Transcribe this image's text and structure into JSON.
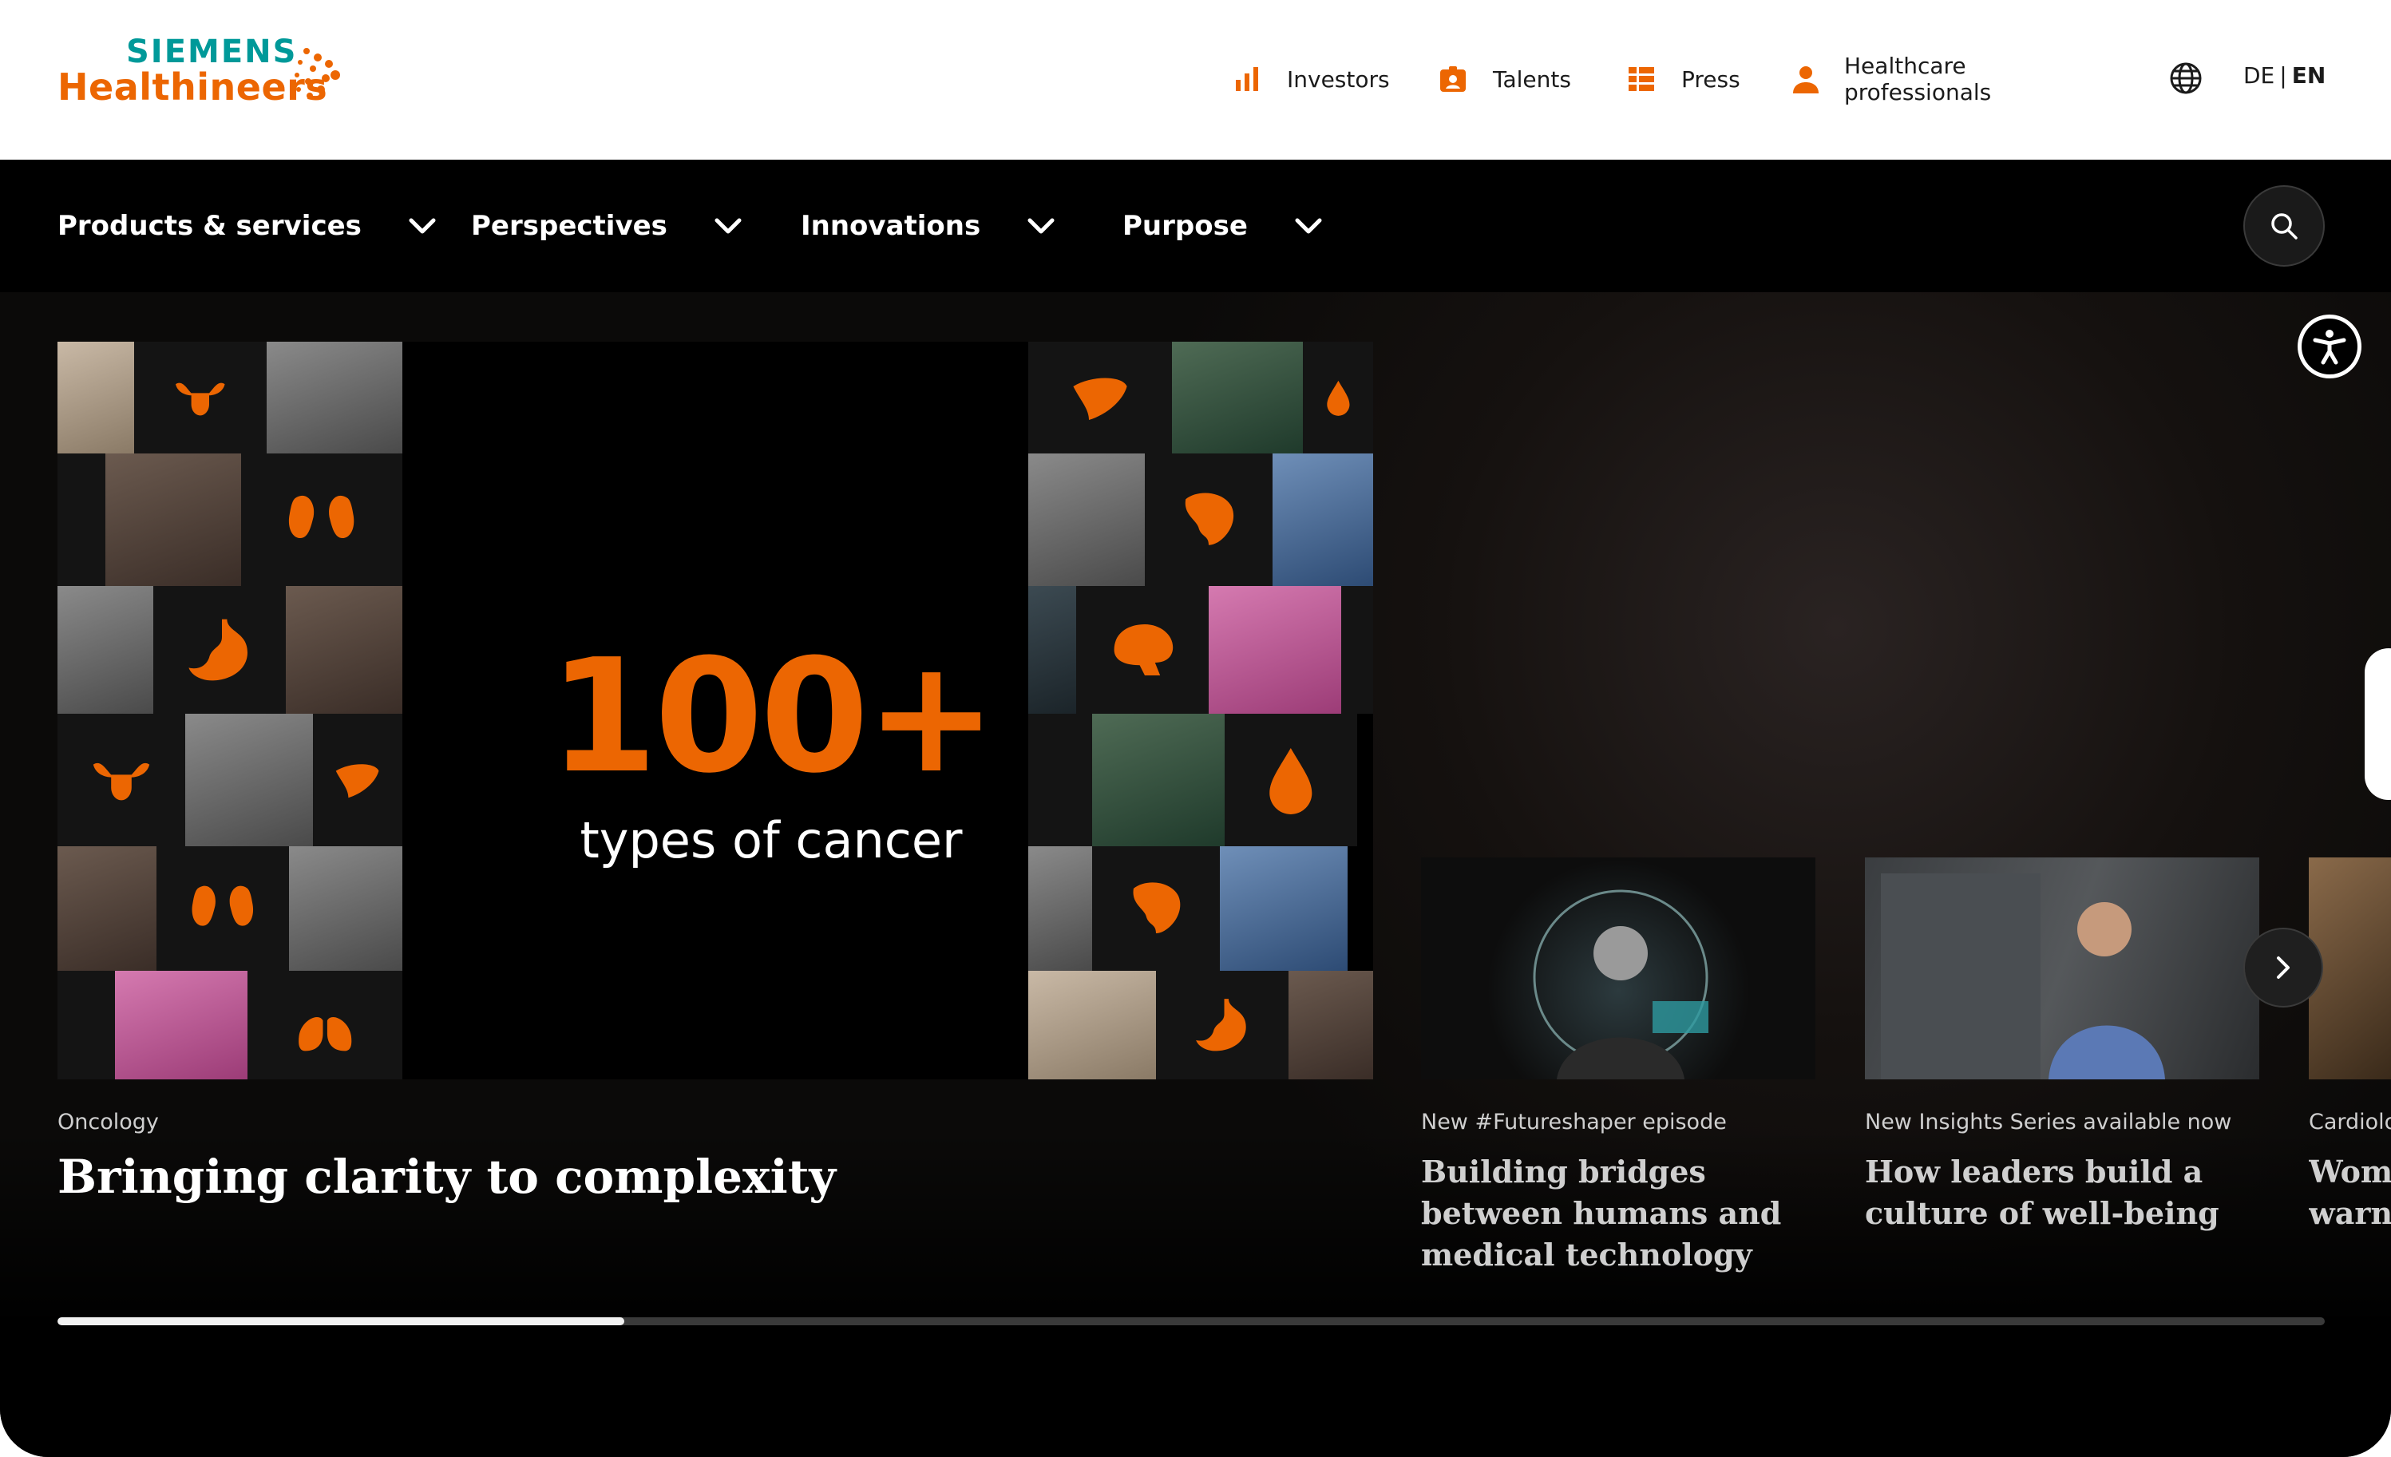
{
  "logo": {
    "line1": "SIEMENS",
    "line2": "Healthineers",
    "color_teal": "#009999",
    "color_orange": "#ec6602"
  },
  "toplinks": [
    {
      "label": "Investors",
      "icon": "bar-chart-icon"
    },
    {
      "label": "Talents",
      "icon": "id-badge-icon"
    },
    {
      "label": "Press",
      "icon": "news-list-icon"
    },
    {
      "label": "Healthcare professionals",
      "icon": "person-icon"
    }
  ],
  "language": {
    "icon": "globe-icon",
    "de": "DE",
    "separator": "|",
    "en": "EN",
    "active": "EN"
  },
  "nav": [
    {
      "label": "Products & services"
    },
    {
      "label": "Perspectives"
    },
    {
      "label": "Innovations"
    },
    {
      "label": "Purpose"
    }
  ],
  "search": {
    "icon": "search-icon"
  },
  "accessibility": {
    "icon": "accessibility-icon"
  },
  "hero": {
    "stat_number": "100+",
    "stat_label": "types of cancer",
    "kicker": "Oncology",
    "headline": "Bringing clarity to complexity"
  },
  "teasers": [
    {
      "kicker": "New #Futureshaper episode",
      "headline": "Building bridges between humans and medical technology"
    },
    {
      "kicker": "New Insights Series available now",
      "headline": "How leaders build a culture of well-being"
    },
    {
      "kicker": "Cardiolo",
      "headline": "Wome warni"
    }
  ],
  "carousel": {
    "next_icon": "chevron-right-icon",
    "progress": 0.25
  },
  "colors": {
    "accent": "#ec6602",
    "nav_bg": "#000000"
  }
}
